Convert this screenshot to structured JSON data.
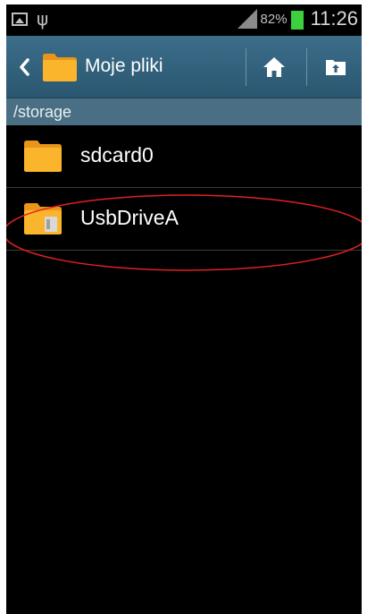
{
  "status_bar": {
    "battery_percent": "82%",
    "time": "11:26",
    "icons": [
      "gallery-icon",
      "usb-icon",
      "signal-icon",
      "battery-icon"
    ]
  },
  "action_bar": {
    "title": "Moje pliki",
    "icons": [
      "back-icon",
      "folder-icon",
      "home-icon",
      "up-folder-icon"
    ]
  },
  "path": "/storage",
  "items": [
    {
      "label": "sdcard0",
      "icon": "folder-icon"
    },
    {
      "label": "UsbDriveA",
      "icon": "usb-folder-icon"
    }
  ],
  "colors": {
    "action_bar": "#2f6078",
    "breadcrumb": "#4a6f84",
    "folder": "#f5a623",
    "highlight": "#e02020"
  }
}
